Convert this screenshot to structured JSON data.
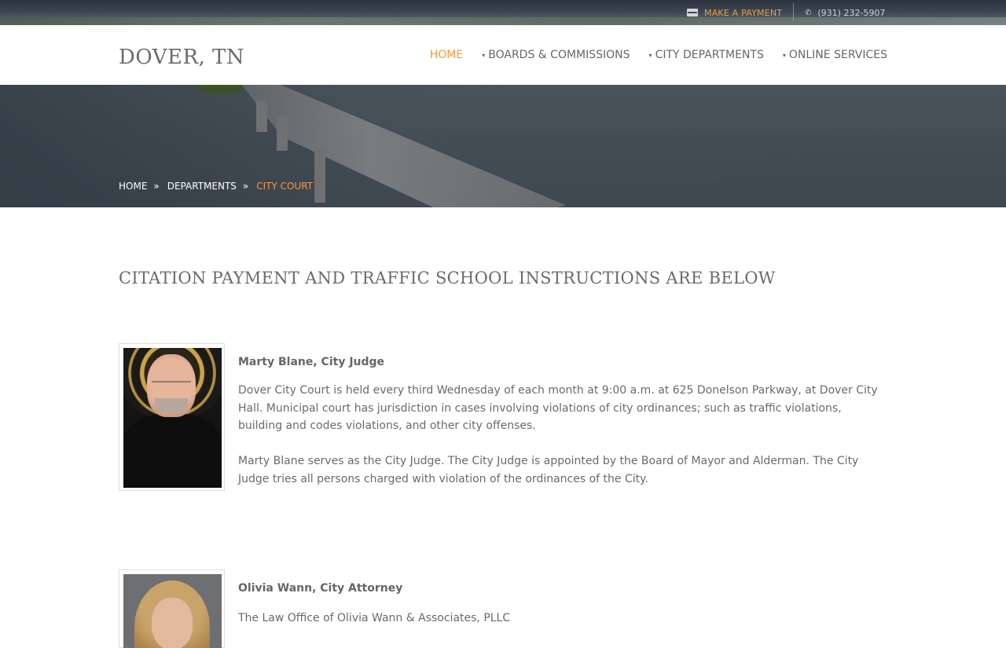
{
  "topbar": {
    "payment_label": "MAKE A PAYMENT",
    "phone": "(931) 232-5907",
    "payment_icon": "credit-card-icon",
    "phone_icon": "phone-icon"
  },
  "header": {
    "logo": "DOVER, TN",
    "nav": [
      {
        "label": "HOME",
        "active": true,
        "has_caret": false
      },
      {
        "label": "BOARDS & COMMISSIONS",
        "active": false,
        "has_caret": true
      },
      {
        "label": "CITY DEPARTMENTS",
        "active": false,
        "has_caret": true
      },
      {
        "label": "ONLINE SERVICES",
        "active": false,
        "has_caret": true
      }
    ],
    "caret": "▾"
  },
  "breadcrumb": {
    "items": [
      "HOME",
      "DEPARTMENTS",
      "CITY COURT"
    ],
    "separator": "»"
  },
  "content": {
    "title": "CITATION PAYMENT AND TRAFFIC SCHOOL INSTRUCTIONS ARE BELOW",
    "people": [
      {
        "name": "Marty Blane, City Judge",
        "paragraphs": [
          "Dover City Court is held every third Wednesday of each month at 9:00 a.m. at 625 Donelson Parkway, at Dover City Hall.  Municipal court has jurisdiction in cases involving violations of city ordinances; such as traffic violations, building and codes violations, and other city offenses.",
          "Marty Blane serves as the City Judge.  The City Judge is appointed by the Board of Mayor and Alderman.  The City Judge tries all persons charged with violation of the ordinances of the City."
        ]
      },
      {
        "name": "Olivia Wann, City Attorney",
        "paragraphs": [
          "The Law Office of Olivia Wann & Associates, PLLC"
        ]
      }
    ]
  },
  "colors": {
    "accent": "#f59a3a",
    "text": "#666666",
    "heading": "#6b6b6b"
  }
}
